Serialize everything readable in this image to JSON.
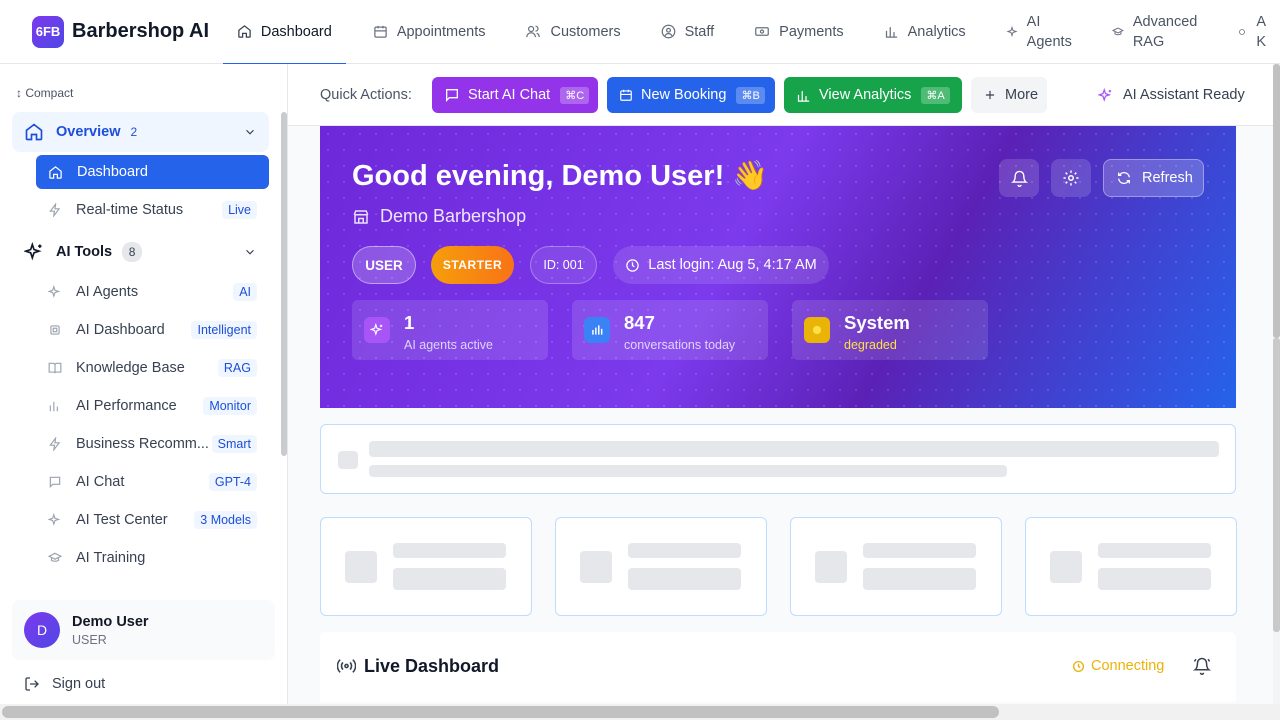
{
  "brand": {
    "logo_text": "6FB",
    "name": "Barbershop AI"
  },
  "nav": {
    "tabs": [
      {
        "label": "Dashboard",
        "icon": "home-icon",
        "active": true
      },
      {
        "label": "Appointments",
        "icon": "calendar-icon"
      },
      {
        "label": "Customers",
        "icon": "users-icon"
      },
      {
        "label": "Staff",
        "icon": "user-circle-icon"
      },
      {
        "label": "Payments",
        "icon": "banknote-icon"
      },
      {
        "label": "Analytics",
        "icon": "bar-chart-icon"
      },
      {
        "label_line1": "AI",
        "label_line2": "Agents",
        "icon": "sparkles-icon"
      },
      {
        "label_line1": "Advanced",
        "label_line2": "RAG",
        "icon": "graduation-cap-icon"
      },
      {
        "label_line1": "A",
        "label_line2": "K",
        "icon": "sparkles-icon"
      }
    ]
  },
  "sidebar": {
    "compact_label": "↕ Compact",
    "overview": {
      "label": "Overview",
      "count": "2"
    },
    "overview_items": [
      {
        "label": "Dashboard",
        "active": true
      },
      {
        "label": "Real-time Status",
        "badge": "Live"
      }
    ],
    "ai_tools": {
      "label": "AI Tools",
      "count": "8"
    },
    "ai_items": [
      {
        "label": "AI Agents",
        "badge": "AI"
      },
      {
        "label": "AI Dashboard",
        "badge": "Intelligent"
      },
      {
        "label": "Knowledge Base",
        "badge": "RAG"
      },
      {
        "label": "AI Performance",
        "badge": "Monitor"
      },
      {
        "label": "Business Recomm...",
        "badge": "Smart"
      },
      {
        "label": "AI Chat",
        "badge": "GPT-4"
      },
      {
        "label": "AI Test Center",
        "badge": "3 Models"
      },
      {
        "label": "AI Training",
        "badge": ""
      }
    ],
    "user": {
      "initial": "D",
      "name": "Demo User",
      "role": "USER"
    },
    "sign_out": "Sign out"
  },
  "quick_actions": {
    "label": "Quick Actions:",
    "buttons": [
      {
        "label": "Start AI Chat",
        "shortcut": "⌘C",
        "color": "#9333ea"
      },
      {
        "label": "New Booking",
        "shortcut": "⌘B",
        "color": "#2563eb"
      },
      {
        "label": "View Analytics",
        "shortcut": "⌘A",
        "color": "#16a34a"
      },
      {
        "label": "More"
      }
    ],
    "status": "AI Assistant Ready"
  },
  "hero": {
    "greeting": "Good evening, Demo User! 👋",
    "shop": "Demo Barbershop",
    "refresh": "Refresh",
    "role_pill": "USER",
    "plan_pill": "STARTER",
    "id_pill": "ID: 001",
    "last_login": "Last login: Aug 5, 4:17 AM",
    "stats": [
      {
        "value": "1",
        "label": "AI agents active"
      },
      {
        "value": "847",
        "label": "conversations today"
      },
      {
        "value": "System",
        "label": "degraded"
      }
    ]
  },
  "live": {
    "title": "Live Dashboard",
    "status": "Connecting"
  },
  "colors": {
    "primary": "#2563eb",
    "hero_start": "#6d28d9",
    "hero_end": "#2563eb",
    "warning": "#eab308"
  }
}
